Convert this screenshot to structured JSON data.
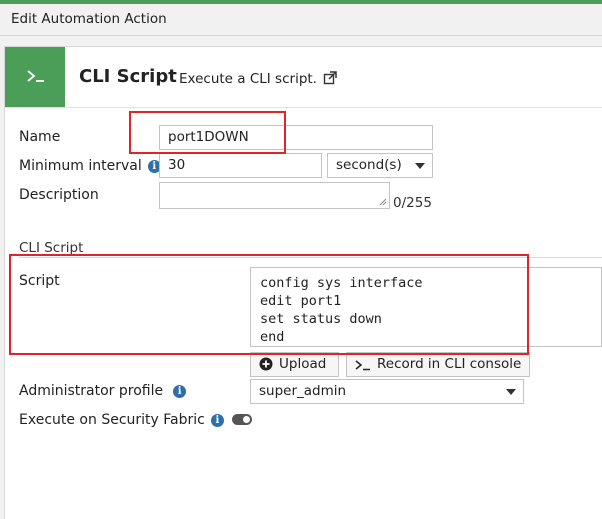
{
  "window": {
    "title": "Edit Automation Action"
  },
  "header": {
    "icon": "terminal-icon",
    "title": "CLI Script",
    "description": "Execute a CLI script.",
    "external_link_icon": "external-link-icon"
  },
  "form": {
    "name": {
      "label": "Name",
      "value": "port1DOWN"
    },
    "min_interval": {
      "label": "Minimum interval",
      "value": "30",
      "unit": "second(s)"
    },
    "description": {
      "label": "Description",
      "value": "",
      "counter": "0/255"
    },
    "cli_section": {
      "title": "CLI Script"
    },
    "script": {
      "label": "Script",
      "value": "config sys interface\nedit port1\nset status down\nend",
      "upload_label": "Upload",
      "record_label": "Record in CLI console"
    },
    "admin_profile": {
      "label": "Administrator profile",
      "value": "super_admin"
    },
    "security_fabric": {
      "label": "Execute on Security Fabric",
      "enabled": false
    }
  },
  "colors": {
    "accent": "#4a9e57",
    "highlight": "#e0242b",
    "info": "#2f6fa7"
  }
}
